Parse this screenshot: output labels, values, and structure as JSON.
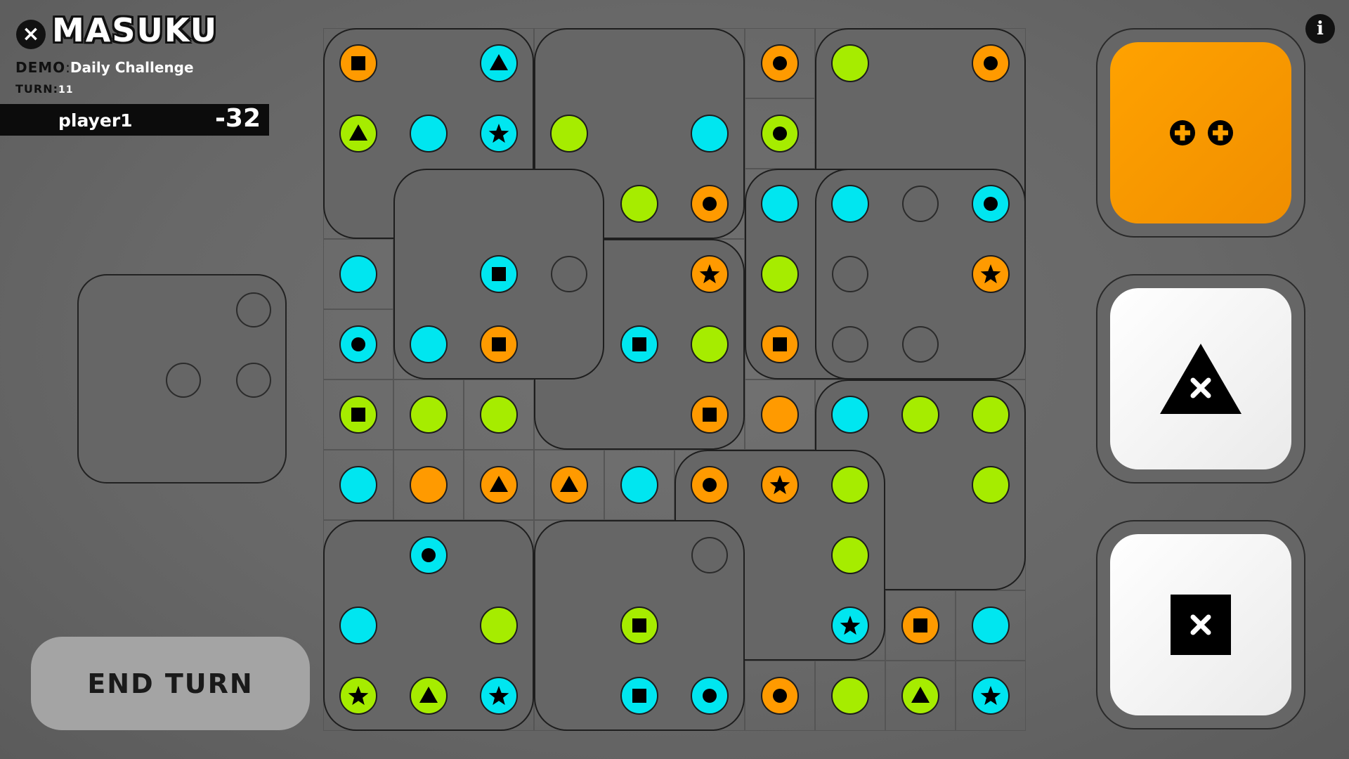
{
  "header": {
    "close_icon": "close-icon",
    "logo_text": "MASUKU",
    "info_icon": "info-icon",
    "mode_label": "DEMO",
    "mode_sep": ":",
    "mode_value": "Daily Challenge",
    "turn_label": "TURN",
    "turn_sep": ":",
    "turn_value": "11"
  },
  "player": {
    "name": "player1",
    "score": "-32"
  },
  "end_turn_label": "END TURN",
  "colors": {
    "orange": "#ff9a00",
    "cyan": "#00e6f0",
    "lime": "#a6ec00",
    "empty": "#666666",
    "die": "#666666",
    "black": "#000000"
  },
  "cards": [
    {
      "id": "double-plus",
      "style": "orange",
      "icon": "double-plus-icon"
    },
    {
      "id": "triangle-remove",
      "style": "white",
      "icon": "triangle-x-icon"
    },
    {
      "id": "square-remove",
      "style": "white",
      "icon": "square-x-icon"
    }
  ],
  "board": {
    "rows": [
      [
        "o:sq",
        "",
        "c:tri",
        "",
        "",
        "",
        "o:dot",
        "l",
        "",
        "o:dot"
      ],
      [
        "l:tri",
        "c",
        "c:star",
        "l",
        "",
        "c",
        "l:dot",
        "",
        "",
        ""
      ],
      [
        "",
        "",
        "",
        "",
        "l",
        "o:dot",
        "c",
        "c",
        "e",
        "c:dot"
      ],
      [
        "c",
        "",
        "c:sq",
        "e",
        "",
        "o:star",
        "l",
        "e",
        "",
        "o:star"
      ],
      [
        "c:dot",
        "c",
        "o:sq",
        "",
        "c:sq",
        "l",
        "o:sq",
        "e",
        "e",
        ""
      ],
      [
        "l:sq",
        "l",
        "l",
        "",
        "",
        "o:sq",
        "o",
        "c",
        "l",
        "l"
      ],
      [
        "c",
        "o",
        "o:tri",
        "o:tri",
        "c",
        "o:dot",
        "o:star",
        "l",
        "",
        "l"
      ],
      [
        "",
        "c:dot",
        "",
        "",
        "",
        "e",
        "",
        "l",
        "",
        ""
      ],
      [
        "c",
        "",
        "l",
        "",
        "l:sq",
        "",
        "",
        "c:star",
        "o:sq",
        "c"
      ],
      [
        "l:star",
        "l:tri",
        "c:star",
        "",
        "c:sq",
        "c:dot",
        "o:dot",
        "l",
        "l:tri",
        "c:star"
      ]
    ],
    "dice": [
      {
        "r": 0,
        "c": 0,
        "w": 3,
        "h": 3,
        "z": 1
      },
      {
        "r": 0,
        "c": 3,
        "w": 3,
        "h": 3,
        "z": 1
      },
      {
        "r": 0,
        "c": 7,
        "w": 3,
        "h": 3,
        "z": 1
      },
      {
        "r": 2,
        "c": 1,
        "w": 3,
        "h": 3,
        "z": 2
      },
      {
        "r": 3,
        "c": 3,
        "w": 3,
        "h": 3,
        "z": 1
      },
      {
        "r": 2,
        "c": 6,
        "w": 2,
        "h": 3,
        "z": 2
      },
      {
        "r": 2,
        "c": 7,
        "w": 3,
        "h": 3,
        "z": 3
      },
      {
        "r": 5,
        "c": 7,
        "w": 3,
        "h": 3,
        "z": 1
      },
      {
        "r": 6,
        "c": 5,
        "w": 3,
        "h": 3,
        "z": 2
      },
      {
        "r": 7,
        "c": 0,
        "w": 3,
        "h": 3,
        "z": 1
      },
      {
        "r": 7,
        "c": 3,
        "w": 3,
        "h": 3,
        "z": 3
      }
    ]
  },
  "preview_die": {
    "slots": [
      {
        "r": 0,
        "c": 2
      },
      {
        "r": 1,
        "c": 1
      },
      {
        "r": 1,
        "c": 2
      }
    ]
  }
}
